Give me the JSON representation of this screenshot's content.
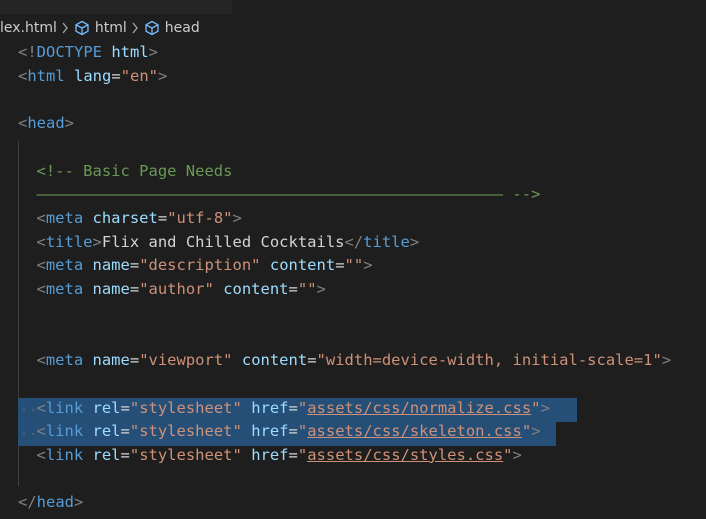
{
  "breadcrumb": {
    "file": "lex.html",
    "items": [
      {
        "label": "html",
        "icon": "symbol-tag-icon"
      },
      {
        "label": "head",
        "icon": "symbol-tag-icon"
      }
    ]
  },
  "editor": {
    "lines": {
      "l1": {
        "punct_open": "<!",
        "keyword": "DOCTYPE",
        "sp": " ",
        "value": "html",
        "punct_close": ">"
      },
      "l2": {
        "open": "<",
        "tag": "html",
        "sp": " ",
        "attr": "lang",
        "eq": "=",
        "val": "\"en\"",
        "close": ">"
      },
      "l4": {
        "open": "<",
        "tag": "head",
        "close": ">"
      },
      "l6": {
        "text": "<!-- Basic Page Needs"
      },
      "l7": {
        "text": "–––––––––––––––––––––––––––––––––––––––––––––––––– -->"
      },
      "l8": {
        "open": "<",
        "tag": "meta",
        "sp": " ",
        "attr": "charset",
        "eq": "=",
        "val": "\"utf-8\"",
        "close": ">"
      },
      "l9": {
        "open": "<",
        "tag": "title",
        "close": ">",
        "text": "Flix and Chilled Cocktails",
        "open2": "</",
        "tag2": "title",
        "close2": ">"
      },
      "l10": {
        "open": "<",
        "tag": "meta",
        "sp": " ",
        "attr1": "name",
        "eq1": "=",
        "val1": "\"description\"",
        "sp2": " ",
        "attr2": "content",
        "eq2": "=",
        "val2": "\"\"",
        "close": ">"
      },
      "l11": {
        "open": "<",
        "tag": "meta",
        "sp": " ",
        "attr1": "name",
        "eq1": "=",
        "val1": "\"author\"",
        "sp2": " ",
        "attr2": "content",
        "eq2": "=",
        "val2": "\"\"",
        "close": ">"
      },
      "l14": {
        "open": "<",
        "tag": "meta",
        "sp": " ",
        "attr1": "name",
        "eq1": "=",
        "val1": "\"viewport\"",
        "sp2": " ",
        "attr2": "content",
        "eq2": "=",
        "val2": "\"width=device-width, initial-scale=1\"",
        "close": ">"
      },
      "l16": {
        "open": "<",
        "tag": "link",
        "sp": " ",
        "attr1": "rel",
        "eq1": "=",
        "val1": "\"stylesheet\"",
        "sp2": " ",
        "attr2": "href",
        "eq2": "=",
        "q1": "\"",
        "href": "assets/css/normalize.css",
        "q2": "\"",
        "close": ">"
      },
      "l17": {
        "open": "<",
        "tag": "link",
        "sp": " ",
        "attr1": "rel",
        "eq1": "=",
        "val1": "\"stylesheet\"",
        "sp2": " ",
        "attr2": "href",
        "eq2": "=",
        "q1": "\"",
        "href": "assets/css/skeleton.css",
        "q2": "\"",
        "close": ">"
      },
      "l18": {
        "open": "<",
        "tag": "link",
        "sp": " ",
        "attr1": "rel",
        "eq1": "=",
        "val1": "\"stylesheet\"",
        "sp2": " ",
        "attr2": "href",
        "eq2": "=",
        "q1": "\"",
        "href": "assets/css/styles.css",
        "q2": "\"",
        "close": ">"
      },
      "l20": {
        "open": "</",
        "tag": "head",
        "close": ">"
      }
    }
  },
  "colors": {
    "background": "#1e1e1e",
    "tag": "#569cd6",
    "attribute": "#9cdcfe",
    "string": "#ce9178",
    "comment": "#6a9955",
    "punctuation": "#808080",
    "selection": "#264f78"
  }
}
